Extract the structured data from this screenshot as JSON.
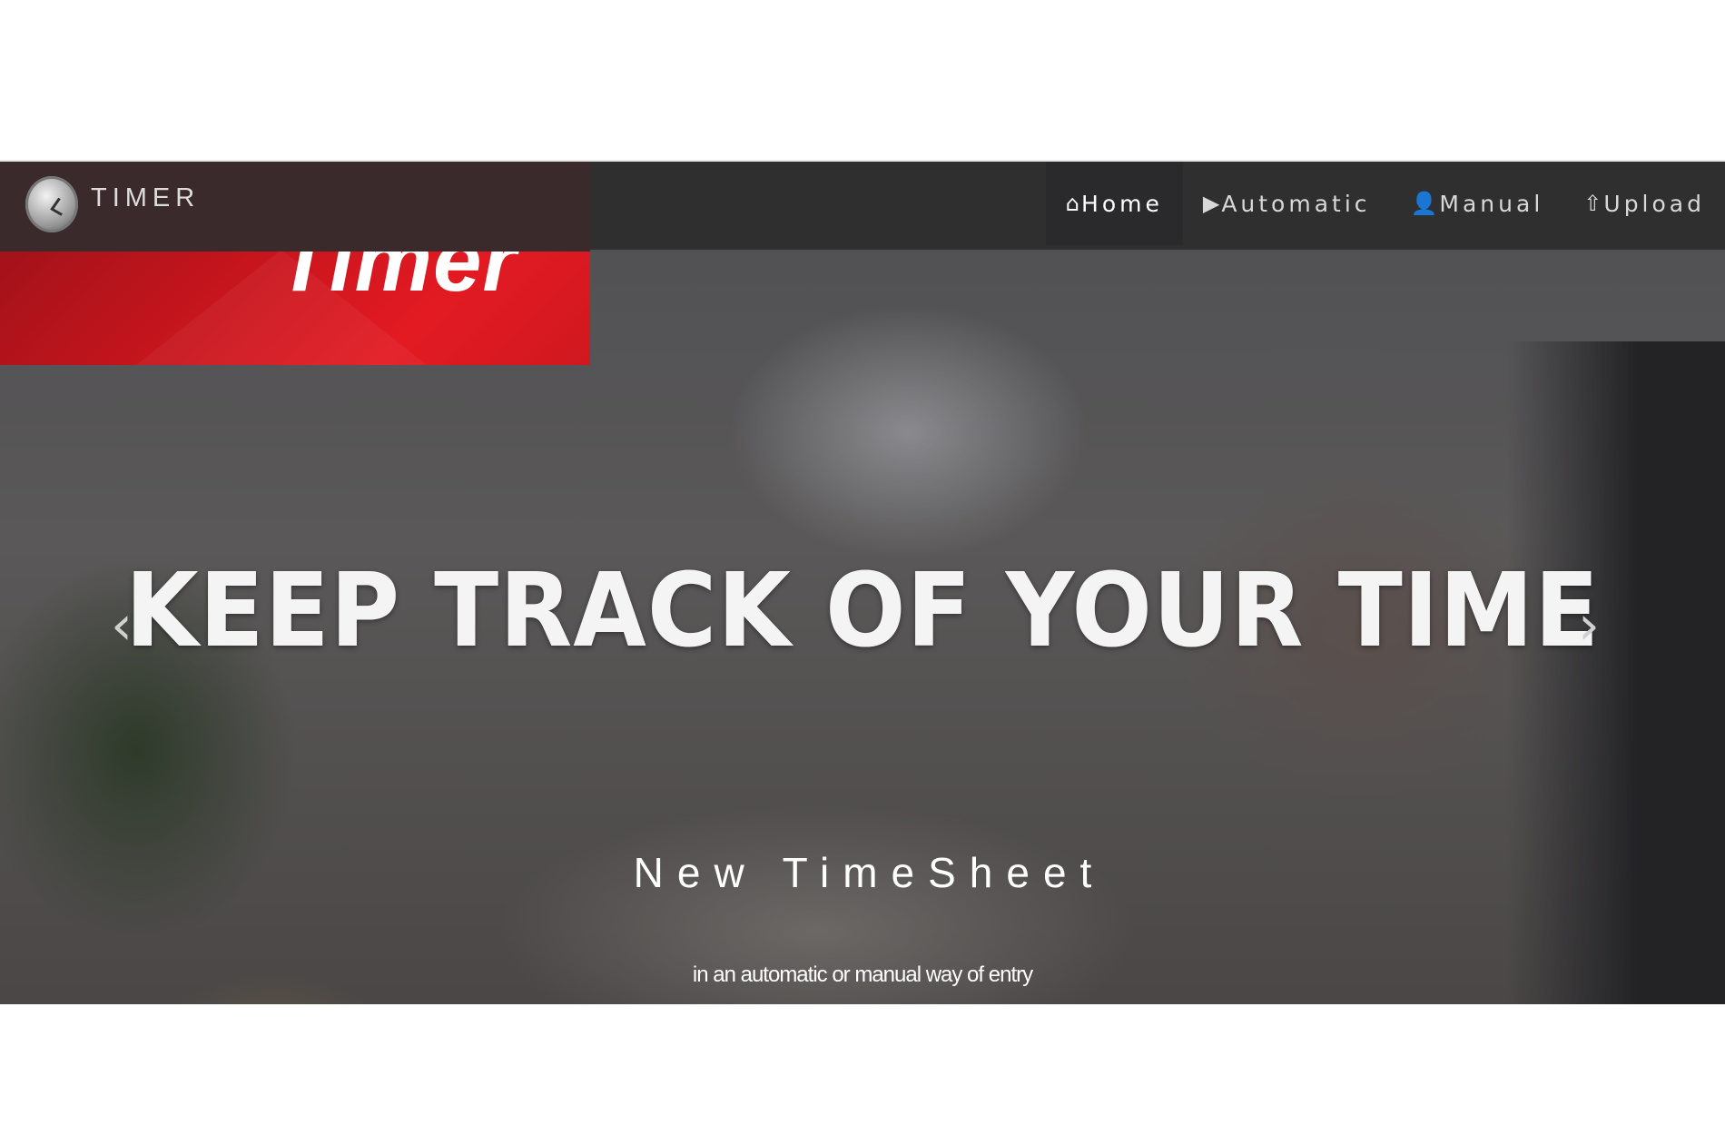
{
  "brand": {
    "name": "TIMER",
    "logo_icon": "clock-icon"
  },
  "nav": {
    "items": [
      {
        "label": "Home",
        "icon": "home-icon",
        "glyph": "⌂",
        "active": true
      },
      {
        "label": "Automatic",
        "icon": "play-icon",
        "glyph": "▶",
        "active": false
      },
      {
        "label": "Manual",
        "icon": "user-icon",
        "glyph": "👤",
        "active": false
      },
      {
        "label": "Upload",
        "icon": "upload-circle-icon",
        "glyph": "⇧",
        "active": false
      }
    ]
  },
  "banner": {
    "title": "Timer",
    "color": "#e31a22"
  },
  "hero": {
    "headline": "KEEP TRACK OF YOUR TIME",
    "subtitle": "New TimeSheet",
    "tagline": "in an automatic or manual way of entry",
    "prev_glyph": "‹",
    "next_glyph": "›"
  }
}
